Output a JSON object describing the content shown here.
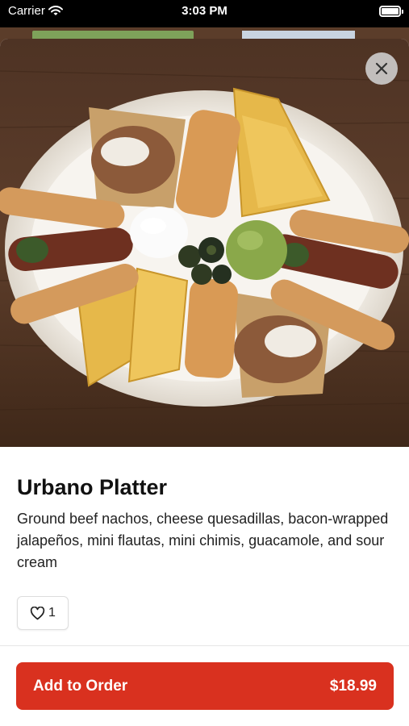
{
  "status_bar": {
    "carrier": "Carrier",
    "time": "3:03 PM"
  },
  "item": {
    "title": "Urbano Platter",
    "description": "Ground beef nachos, cheese quesadillas, bacon-wrapped jalapeños, mini flautas, mini chimis, guacamole, and sour cream",
    "like_count": "1"
  },
  "order": {
    "label": "Add to Order",
    "price": "$18.99"
  },
  "colors": {
    "accent": "#d9311f"
  },
  "icons": {
    "close": "close-icon",
    "like": "heart-outline-icon"
  }
}
